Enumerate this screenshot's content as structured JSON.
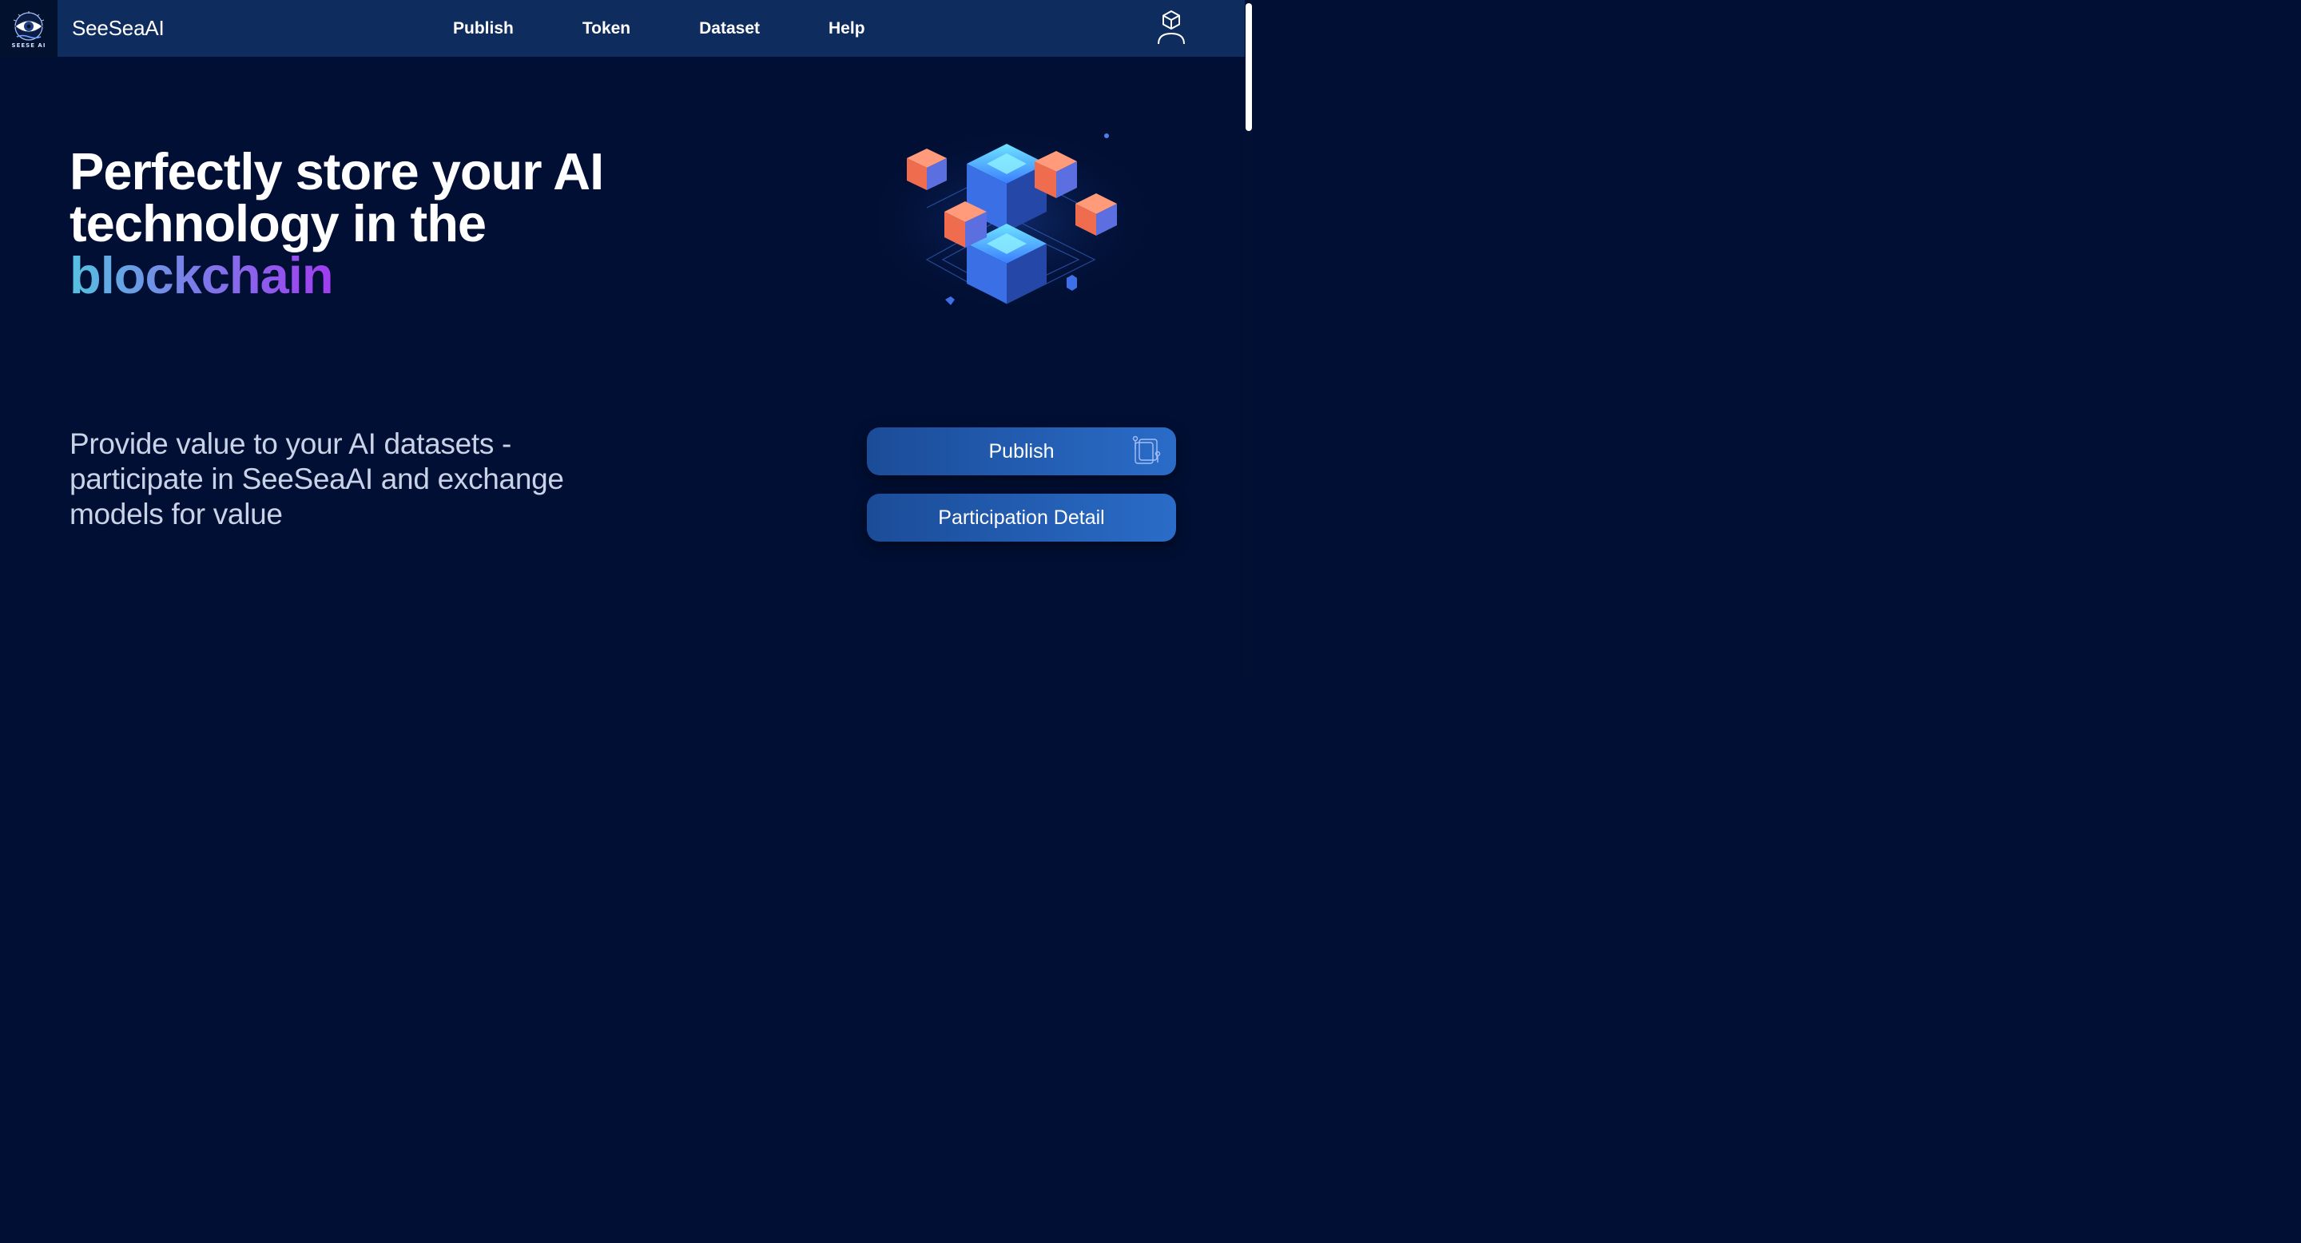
{
  "header": {
    "brand": "SeeSeaAI",
    "logo_text": "SEESE AI",
    "nav": [
      "Publish",
      "Token",
      "Dataset",
      "Help"
    ],
    "user_icon": "user-cube-icon"
  },
  "hero": {
    "title_line1": "Perfectly store your AI",
    "title_line2": "technology in the",
    "title_highlight": "blockchain",
    "subtitle": "Provide value to your AI datasets - participate in SeeSeaAI and exchange models for value"
  },
  "actions": {
    "publish_label": "Publish",
    "publish_icon": "document-layers-icon",
    "detail_label": "Participation Detail"
  },
  "colors": {
    "background": "#010f34",
    "navbar": "#0f2c5e",
    "button_start": "#1b4c98",
    "button_end": "#2a6cc8",
    "cube_blue": "#3f7cf0",
    "cube_orange": "#f5795c",
    "gradient": [
      "#56c1e1",
      "#7a7fe8",
      "#a13cf0"
    ]
  }
}
